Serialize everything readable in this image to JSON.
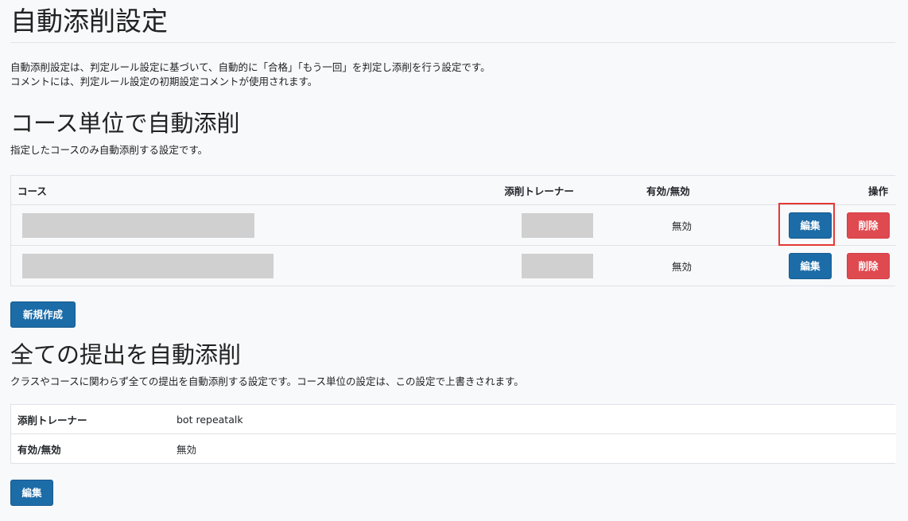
{
  "page": {
    "title": "自動添削設定",
    "description": [
      "自動添削設定は、判定ルール設定に基づいて、自動的に「合格」「もう一回」を判定し添削を行う設定です。",
      "コメントには、判定ルール設定の初期設定コメントが使用されます。"
    ]
  },
  "course_section": {
    "title": "コース単位で自動添削",
    "description": "指定したコースのみ自動添削する設定です。",
    "columns": {
      "course": "コース",
      "trainer": "添削トレーナー",
      "status": "有効/無効",
      "actions": "操作"
    },
    "rows": [
      {
        "course": "",
        "trainer": "",
        "status": "無効",
        "edit_label": "編集",
        "delete_label": "削除"
      },
      {
        "course": "",
        "trainer": "",
        "status": "無効",
        "edit_label": "編集",
        "delete_label": "削除"
      }
    ],
    "new_button_label": "新規作成"
  },
  "all_section": {
    "title": "全ての提出を自動添削",
    "description": "クラスやコースに関わらず全ての提出を自動添削する設定です。コース単位の設定は、この設定で上書きされます。",
    "rows": [
      {
        "key": "添削トレーナー",
        "value": "bot repeatalk"
      },
      {
        "key": "有効/無効",
        "value": "無効"
      }
    ],
    "edit_label": "編集"
  },
  "colors": {
    "primary": "#1c6ca8",
    "danger": "#df4a50",
    "highlight": "#e53935"
  }
}
